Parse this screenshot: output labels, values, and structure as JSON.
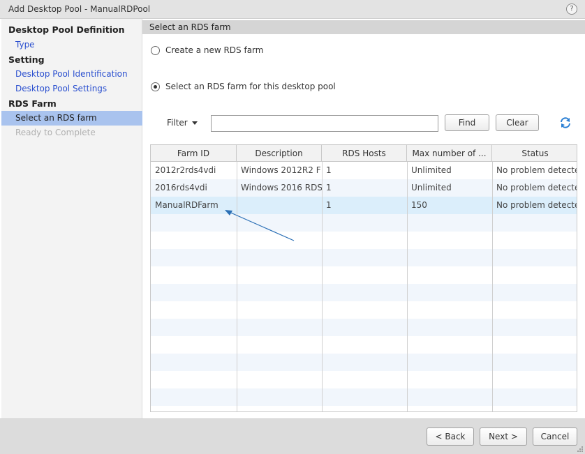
{
  "window": {
    "title": "Add Desktop Pool - ManualRDPool",
    "help_label": "?"
  },
  "sidebar": {
    "items": [
      {
        "label": "Desktop Pool Definition",
        "kind": "head"
      },
      {
        "label": "Type",
        "kind": "link"
      },
      {
        "label": "Setting",
        "kind": "head"
      },
      {
        "label": "Desktop Pool Identification",
        "kind": "link"
      },
      {
        "label": "Desktop Pool Settings",
        "kind": "link"
      },
      {
        "label": "RDS Farm",
        "kind": "head"
      },
      {
        "label": "Select an RDS farm",
        "kind": "active"
      },
      {
        "label": "Ready to Complete",
        "kind": "disabled"
      }
    ]
  },
  "main": {
    "section_title": "Select an RDS farm",
    "option_new": "Create a new RDS farm",
    "option_existing": "Select an RDS farm for this desktop pool",
    "selected_option": "existing",
    "filter_label": "Filter",
    "filter_value": "",
    "find_label": "Find",
    "clear_label": "Clear",
    "refresh_icon": "refresh-icon"
  },
  "table": {
    "columns": [
      "Farm ID",
      "Description",
      "RDS Hosts",
      "Max number of ...",
      "Status"
    ],
    "rows": [
      [
        "2012r2rds4vdi",
        "Windows 2012R2 F",
        "1",
        "Unlimited",
        "No problem detecte"
      ],
      [
        "2016rds4vdi",
        "Windows 2016 RDS",
        "1",
        "Unlimited",
        "No problem detecte"
      ],
      [
        "ManualRDFarm",
        "",
        "1",
        "150",
        "No problem detecte"
      ]
    ],
    "selected_row": 2,
    "accent_color": "#2a6fb5"
  },
  "footer": {
    "back_label": "< Back",
    "next_label": "Next >",
    "cancel_label": "Cancel"
  }
}
